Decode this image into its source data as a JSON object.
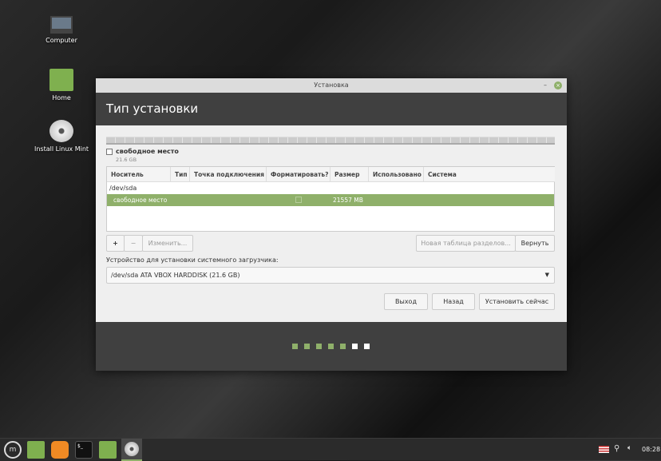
{
  "desktop": {
    "icons": [
      {
        "label": "Computer"
      },
      {
        "label": "Home"
      },
      {
        "label": "Install Linux Mint"
      }
    ]
  },
  "window": {
    "title": "Установка",
    "heading": "Тип установки",
    "free_space": {
      "label": "свободное место",
      "size": "21.6 GB"
    },
    "table": {
      "columns": [
        "Носитель",
        "Тип",
        "Точка подключения",
        "Форматировать?",
        "Размер",
        "Использовано",
        "Система"
      ],
      "device": "/dev/sda",
      "rows": [
        {
          "device": "свободное место",
          "size": "21557 MB"
        }
      ]
    },
    "buttons": {
      "add": "+",
      "remove": "−",
      "change": "Изменить...",
      "new_table": "Новая таблица разделов...",
      "revert": "Вернуть",
      "quit": "Выход",
      "back": "Назад",
      "install": "Установить сейчас"
    },
    "bootloader_label": "Устройство для установки системного загрузчика:",
    "bootloader_value": "/dev/sda ATA VBOX HARDDISK (21.6 GB)",
    "progress": {
      "current_step": 5,
      "total_steps": 7
    }
  },
  "taskbar": {
    "clock": "08:28"
  },
  "colors": {
    "accent": "#8fb06a",
    "header": "#404040"
  }
}
